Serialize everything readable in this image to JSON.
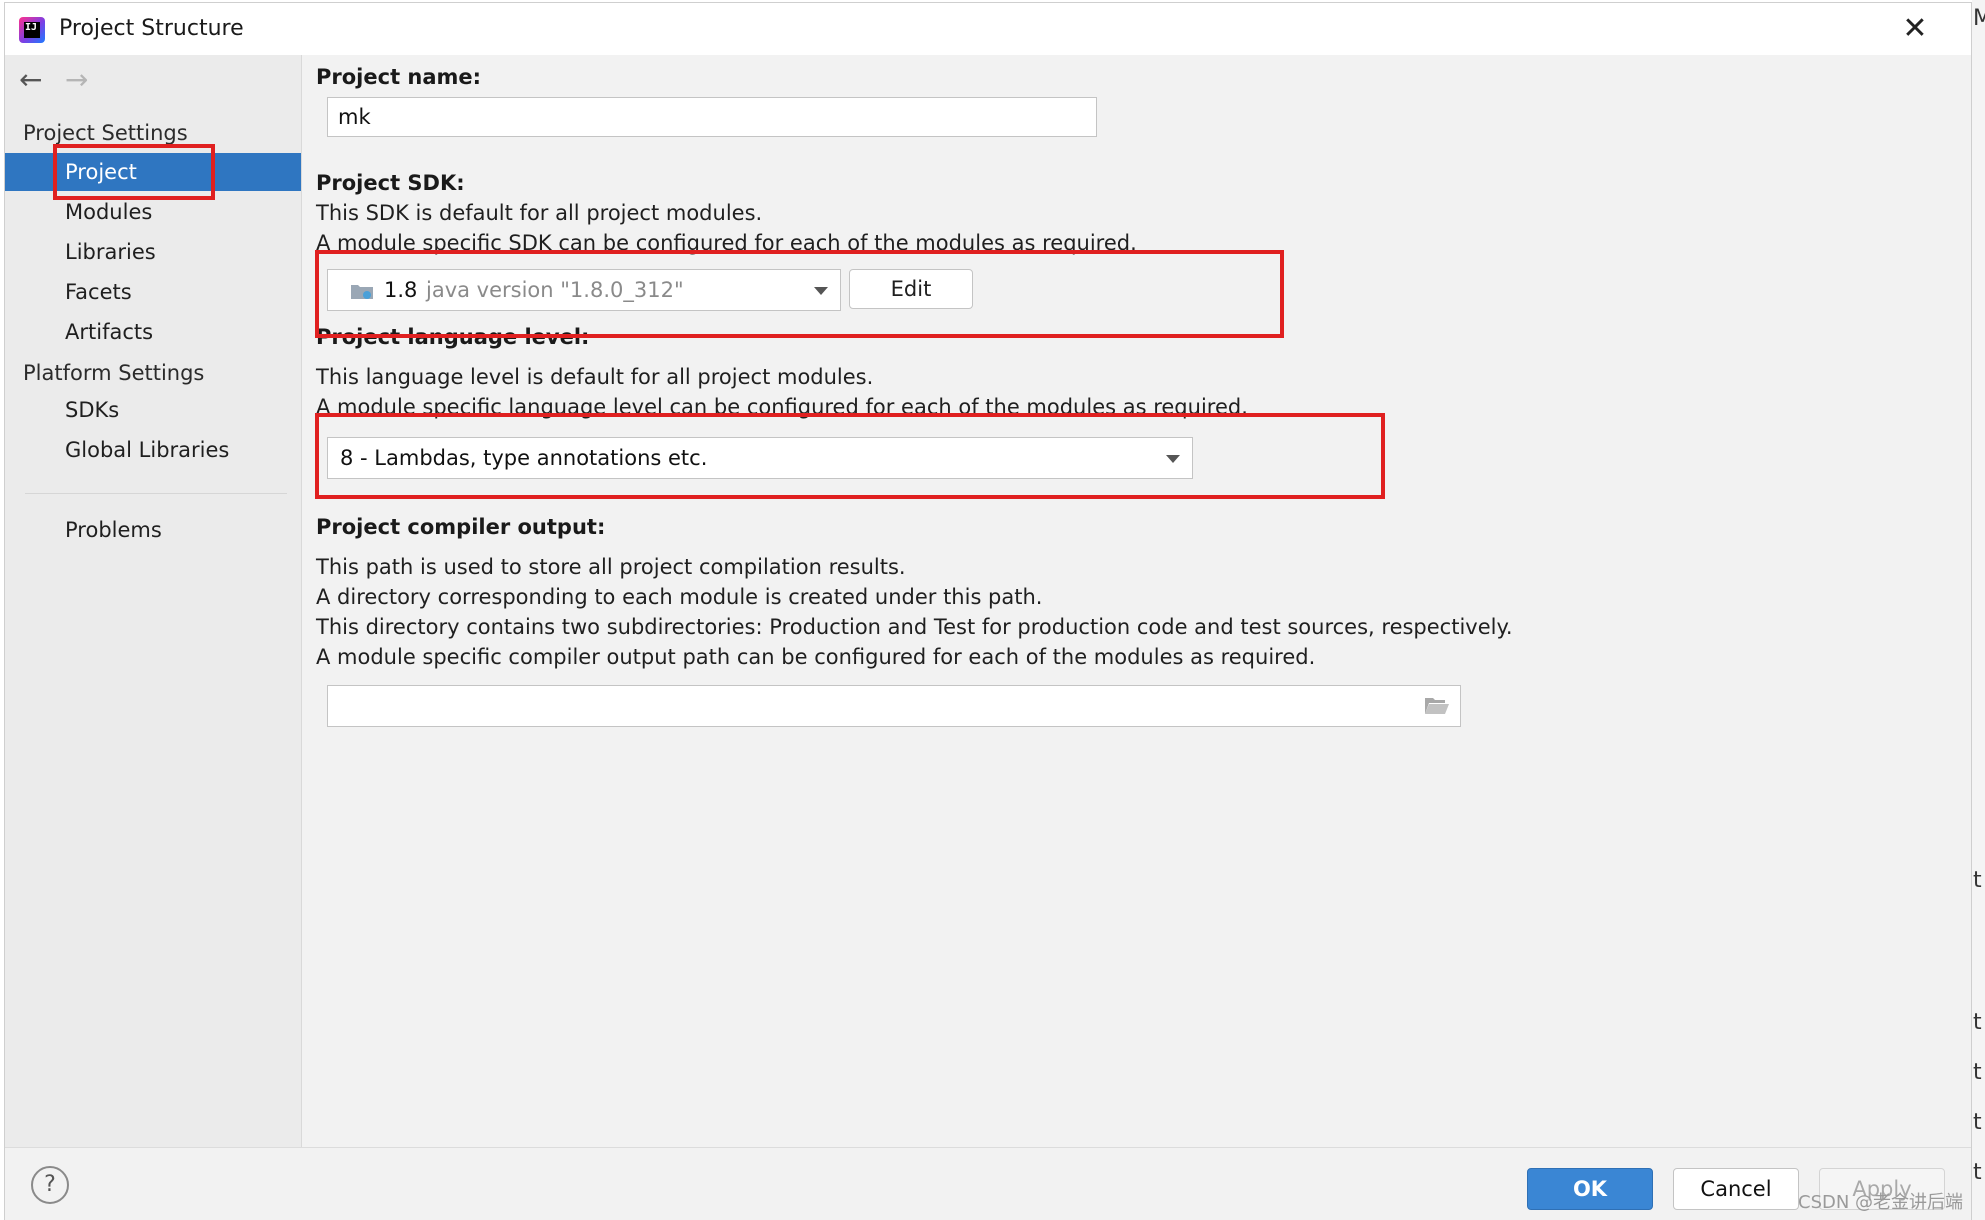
{
  "window": {
    "title": "Project Structure"
  },
  "nav": {
    "back_icon": "arrow-left-icon",
    "forward_icon": "arrow-right-icon"
  },
  "sidebar": {
    "project_settings_header": "Project Settings",
    "project_items": [
      "Project",
      "Modules",
      "Libraries",
      "Facets",
      "Artifacts"
    ],
    "selected_item": "Project",
    "platform_settings_header": "Platform Settings",
    "platform_items": [
      "SDKs",
      "Global Libraries"
    ],
    "problems": "Problems"
  },
  "content": {
    "project_name_label": "Project name:",
    "project_name_value": "mk",
    "sdk_label": "Project SDK:",
    "sdk_desc1": "This SDK is default for all project modules.",
    "sdk_desc2": "A module specific SDK can be configured for each of the modules as required.",
    "sdk_selected_name": "1.8",
    "sdk_selected_version": "java version \"1.8.0_312\"",
    "edit_button": "Edit",
    "lang_label": "Project language level:",
    "lang_desc1": "This language level is default for all project modules.",
    "lang_desc2": "A module specific language level can be configured for each of the modules as required.",
    "lang_selected": "8 - Lambdas, type annotations etc.",
    "output_label": "Project compiler output:",
    "output_desc1": "This path is used to store all project compilation results.",
    "output_desc2": "A directory corresponding to each module is created under this path.",
    "output_desc3": "This directory contains two subdirectories: Production and Test for production code and test sources, respectively.",
    "output_desc4": "A module specific compiler output path can be configured for each of the modules as required.",
    "output_path_value": ""
  },
  "footer": {
    "help": "?",
    "ok": "OK",
    "cancel": "Cancel",
    "apply": "Apply"
  },
  "watermark": "CSDN @老金讲后端",
  "background_fragments": [
    "Ma",
    "t",
    "t",
    "t",
    "t",
    "t"
  ],
  "colors": {
    "selection": "#2f76c1",
    "ok_button": "#3a86d4",
    "highlight_box": "#e02020"
  }
}
